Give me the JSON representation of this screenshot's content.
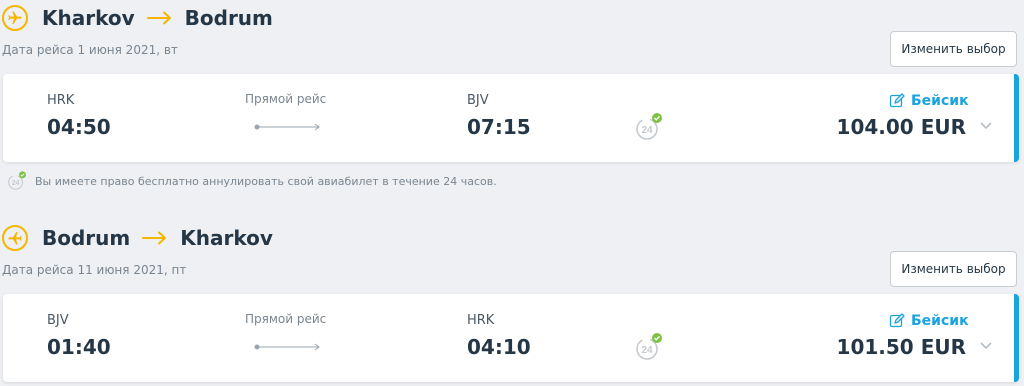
{
  "segments": [
    {
      "from_city": "Kharkov",
      "to_city": "Bodrum",
      "date": "Дата рейса 1 июня 2021, вт",
      "change_label": "Изменить выбор",
      "dep_code": "HRK",
      "dep_time": "04:50",
      "direct_label": "Прямой рейс",
      "arr_code": "BJV",
      "arr_time": "07:15",
      "fare_name": "Бейсик",
      "price": "104.00 EUR",
      "direction": "outbound"
    },
    {
      "from_city": "Bodrum",
      "to_city": "Kharkov",
      "date": "Дата рейса 11 июня 2021, пт",
      "change_label": "Изменить выбор",
      "dep_code": "BJV",
      "dep_time": "01:40",
      "direct_label": "Прямой рейс",
      "arr_code": "HRK",
      "arr_time": "04:10",
      "fare_name": "Бейсик",
      "price": "101.50 EUR",
      "direction": "return"
    }
  ],
  "refund_note": "Вы имеете право бесплатно аннулировать свой авиабилет в течение 24 часов.",
  "icons": {
    "plane": "plane-icon",
    "route_arrow": "arrow-right-icon",
    "flight_line": "flight-line-icon",
    "refund_24h": "24h-refund-icon",
    "fare_edit": "edit-icon",
    "expand": "chevron-down-icon"
  },
  "colors": {
    "accent": "#1aa3df",
    "plane": "#f7b500",
    "check": "#7cc242",
    "text": "#253746",
    "muted": "#7a8591",
    "background": "#eef0f3"
  }
}
